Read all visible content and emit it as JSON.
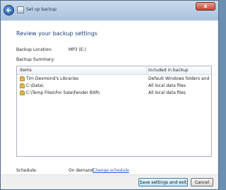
{
  "window": {
    "title": "Set up backup",
    "close_glyph": "x"
  },
  "heading": "Review your backup settings",
  "backup_location": {
    "label": "Backup Location:",
    "value": "MP3 (E:)"
  },
  "summary": {
    "label": "Backup Summary:",
    "columns": [
      "Items",
      "Included in backup"
    ],
    "rows": [
      {
        "item": "Tim Desmond's Libraries",
        "included": "Default Windows folders and lo..."
      },
      {
        "item": "C:\\Data\\",
        "included": "All local data files"
      },
      {
        "item": "C:\\Temp Files\\For Sale\\Fender BXR\\",
        "included": "All local data files"
      }
    ]
  },
  "schedule": {
    "label": "Schedule:",
    "value": "On demand",
    "link": "Change schedule"
  },
  "buttons": {
    "save": "Save settings and exit",
    "cancel": "Cancel"
  },
  "icons": {
    "back": "back-arrow-icon",
    "folder": "folder-icon",
    "close": "close-icon"
  }
}
